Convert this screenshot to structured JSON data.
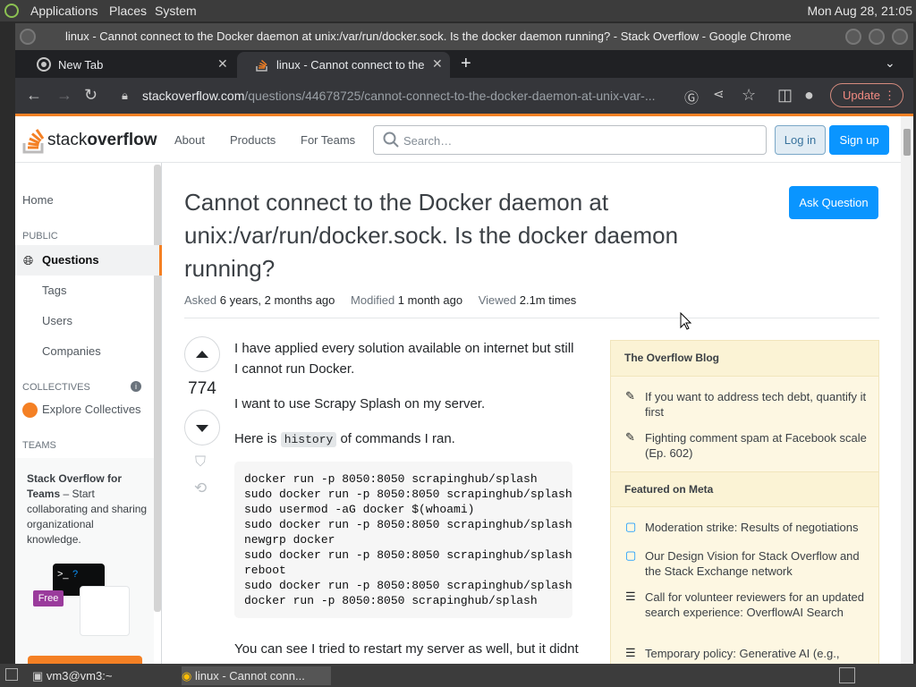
{
  "top_panel": {
    "menus": [
      "Applications",
      "Places",
      "System"
    ],
    "clock": "Mon Aug 28, 21:05"
  },
  "window": {
    "title": "linux - Cannot connect to the Docker daemon at unix:/var/run/docker.sock. Is the docker daemon running? - Stack Overflow - Google Chrome"
  },
  "tabs": [
    {
      "label": "New Tab"
    },
    {
      "label": "linux - Cannot connect to the D"
    }
  ],
  "toolbar": {
    "url_host": "stackoverflow.com",
    "url_path": "/questions/44678725/cannot-connect-to-the-docker-daemon-at-unix-var-...",
    "update_label": "Update"
  },
  "so_header": {
    "logo_stack": "stack",
    "logo_overflow": "overflow",
    "nav": [
      "About",
      "Products",
      "For Teams"
    ],
    "search_placeholder": "Search…",
    "login": "Log in",
    "signup": "Sign up"
  },
  "left_nav": {
    "home": "Home",
    "public": "PUBLIC",
    "questions": "Questions",
    "tags": "Tags",
    "users": "Users",
    "companies": "Companies",
    "collectives": "COLLECTIVES",
    "explore": "Explore Collectives",
    "teams": "TEAMS",
    "teams_title": "Stack Overflow for Teams",
    "teams_text": " – Start collaborating and sharing organizational knowledge.",
    "free": "Free"
  },
  "question": {
    "title": "Cannot connect to the Docker daemon at unix:/var/run/docker.sock. Is the docker daemon running?",
    "ask": "Ask Question",
    "asked_label": "Asked",
    "asked": "6 years, 2 months ago",
    "modified_label": "Modified",
    "modified": "1 month ago",
    "viewed_label": "Viewed",
    "viewed": "2.1m times",
    "score": "774",
    "p1": "I have applied every solution available on internet but still I cannot run Docker.",
    "p2": "I want to use Scrapy Splash on my server.",
    "p3_pre": "Here is ",
    "p3_code": "history",
    "p3_post": " of commands I ran.",
    "code": "docker run -p 8050:8050 scrapinghub/splash\nsudo docker run -p 8050:8050 scrapinghub/splash\nsudo usermod -aG docker $(whoami)\nsudo docker run -p 8050:8050 scrapinghub/splash\nnewgrp docker\nsudo docker run -p 8050:8050 scrapinghub/splash\nreboot\nsudo docker run -p 8050:8050 scrapinghub/splash\ndocker run -p 8050:8050 scrapinghub/splash",
    "p4": "You can see I tried to restart my server as well, but it didnt help."
  },
  "sidebar": {
    "blog_title": "The Overflow Blog",
    "blog": [
      "If you want to address tech debt, quantify it first",
      "Fighting comment spam at Facebook scale (Ep. 602)"
    ],
    "meta_title": "Featured on Meta",
    "meta": [
      "Moderation strike: Results of negotiations",
      "Our Design Vision for Stack Overflow and the Stack Exchange network",
      "Call for volunteer reviewers for an updated search experience: OverflowAI Search",
      "Temporary policy: Generative AI (e.g., ChatGPT) is banned"
    ]
  },
  "taskbar": {
    "items": [
      "vm3@vm3:~",
      "linux - Cannot conn..."
    ]
  },
  "colors": {
    "accent": "#f48024",
    "primary_button": "#0a95ff"
  }
}
